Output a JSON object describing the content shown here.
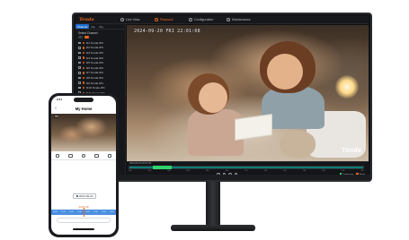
{
  "monitor": {
    "brand": "Tenda",
    "nav": [
      {
        "label": "Live View",
        "active": false
      },
      {
        "label": "Playback",
        "active": true
      },
      {
        "label": "Configuration",
        "active": false
      },
      {
        "label": "Maintenance",
        "active": false
      }
    ],
    "sidebar": {
      "tabs": [
        "Channel",
        "File",
        "Tag"
      ],
      "heading": "Select Channel",
      "channels": [
        "D1 Tenda IPC",
        "D2 Tenda IPC",
        "D3 Tenda IPC",
        "D4 Tenda IPC",
        "D5 Tenda IPC",
        "D6 Tenda IPC",
        "D7 Tenda IPC",
        "D8 Tenda IPC",
        "D9 Tenda IPC",
        "D10 Tenda IPC",
        "D11 Tenda IPC",
        "D12 Tenda IPC",
        "D13 Tenda IPC",
        "D14 Tenda IPC",
        "D15 Tenda IPC",
        "D16 Tenda IPC"
      ]
    },
    "osd_timestamp": "2024-09-20  FRI  22:01:08",
    "watermark": "Tenda",
    "timeline": {
      "label": "2024-09-20  22:01:08",
      "ticks": [
        "00h",
        "02h",
        "04h",
        "06h",
        "08h",
        "10h",
        "12h",
        "14h",
        "16h",
        "18h",
        "20h",
        "22h",
        "24h"
      ],
      "legend": [
        {
          "label": "Continuous",
          "color": "#2fd36b"
        },
        {
          "label": "Event",
          "color": "#e8641c"
        }
      ]
    }
  },
  "phone": {
    "status_time": "9:41",
    "title": "My Home",
    "hd_badge": "HD",
    "date": "2024-09-20",
    "current_time": "22:01:08",
    "timeline_ticks": [
      "16:00",
      "17:00",
      "18:00",
      "19:00",
      "20:00",
      "21:00",
      "22:00",
      "23:00"
    ]
  },
  "colors": {
    "accent": "#e8641c",
    "recording": "#0d7d74",
    "phone_timeline": "#4b8fe0"
  }
}
